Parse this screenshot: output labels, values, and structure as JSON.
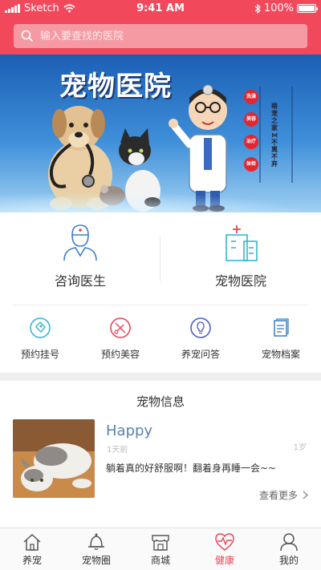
{
  "status_bar": {
    "carrier": "Sketch",
    "time": "9:41 AM",
    "battery": "100%",
    "battery_level": 1.0
  },
  "search": {
    "placeholder": "输入要查找的医院"
  },
  "banner": {
    "title": "宠物医院",
    "tags": [
      "洗澡",
      "美容",
      "治疗",
      "体检"
    ],
    "slogan": "萌宠之家 ⋈ 不离不弃"
  },
  "entries": [
    {
      "label": "咨询医生",
      "icon": "doctor-icon"
    },
    {
      "label": "宠物医院",
      "icon": "hospital-icon"
    }
  ],
  "quick_actions": [
    {
      "label": "预约挂号",
      "icon": "register-tag-icon",
      "color": "#34b7c9"
    },
    {
      "label": "预约美容",
      "icon": "grooming-icon",
      "color": "#e8475a"
    },
    {
      "label": "养宠问答",
      "icon": "lightbulb-icon",
      "color": "#4a5fc9"
    },
    {
      "label": "宠物档案",
      "icon": "file-icon",
      "color": "#3b7fc6"
    }
  ],
  "pet_info": {
    "section_title": "宠物信息",
    "name": "Happy",
    "time": "1天前",
    "age": "1岁",
    "description": "躺着真的好舒服啊！翻着身再睡一会~~",
    "more_label": "查看更多"
  },
  "tabbar": [
    {
      "label": "养宠",
      "icon": "home-icon",
      "active": false
    },
    {
      "label": "宠物圈",
      "icon": "bell-icon",
      "active": false
    },
    {
      "label": "商城",
      "icon": "shop-icon",
      "active": false
    },
    {
      "label": "健康",
      "icon": "heart-pulse-icon",
      "active": true
    },
    {
      "label": "我的",
      "icon": "user-icon",
      "active": false
    }
  ],
  "colors": {
    "brand": "#f2485c",
    "active_tab": "#e8475a",
    "accent_teal": "#34b7c9",
    "pet_name": "#5a7fb5"
  }
}
